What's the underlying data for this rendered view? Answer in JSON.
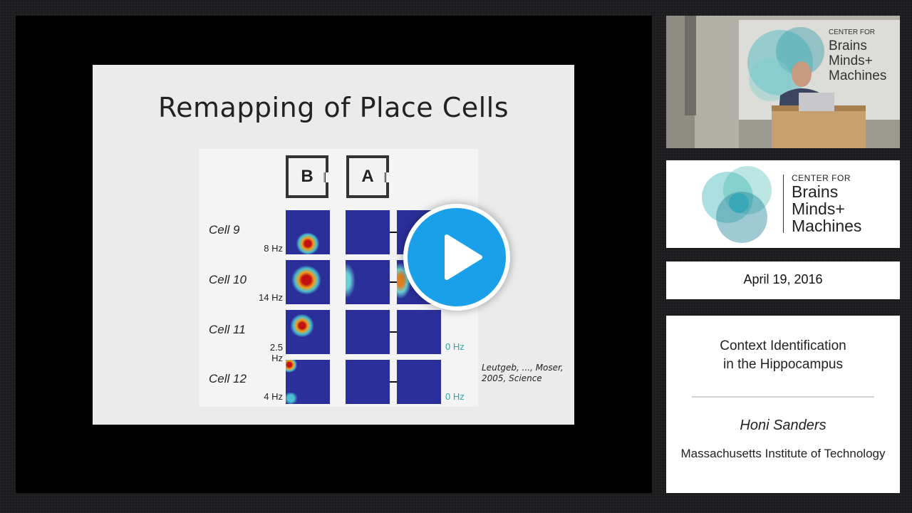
{
  "slide": {
    "title": "Remapping of Place Cells",
    "environments": [
      "B",
      "A"
    ],
    "cells": [
      {
        "name": "Cell 9",
        "rate": "8 Hz",
        "zero": ""
      },
      {
        "name": "Cell 10",
        "rate": "14 Hz",
        "zero": ""
      },
      {
        "name": "Cell 11",
        "rate": "2.5 Hz",
        "zero": "0 Hz"
      },
      {
        "name": "Cell 12",
        "rate": "4 Hz",
        "zero": "0 Hz"
      }
    ],
    "citation": "Leutgeb, ..., Moser, 2005, Science"
  },
  "logo": {
    "line1": "CENTER FOR",
    "line2": "Brains",
    "line3": "Minds+",
    "line4": "Machines"
  },
  "date": "April 19, 2016",
  "talk": {
    "title": "Context Identification\nin the Hippocampus",
    "speaker": "Honi Sanders",
    "affiliation": "Massachusetts Institute of Technology"
  },
  "colors": {
    "play_button": "#1aa0e8",
    "heatmap_base": "#2b2f9a",
    "zero_rate_text": "#2ca8a8",
    "logo_teal": "#3bb8b0"
  },
  "icons": {
    "play": "play-icon",
    "logo": "brain-circles-logo"
  }
}
